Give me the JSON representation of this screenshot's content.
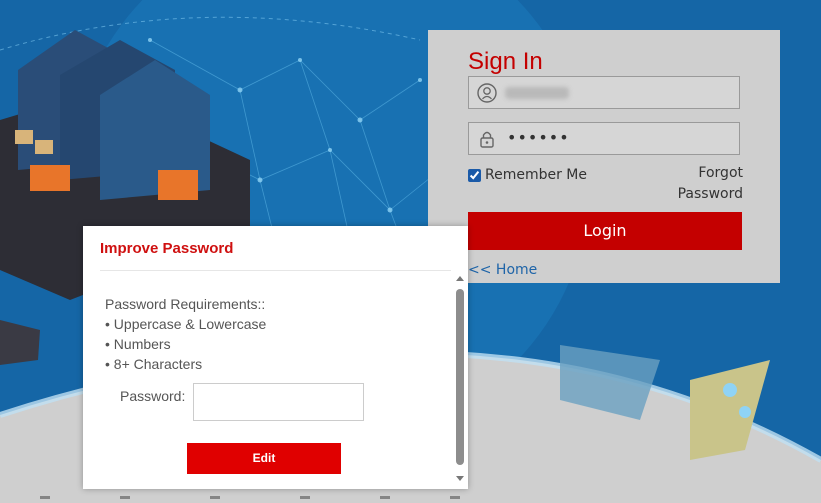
{
  "signin": {
    "title": "Sign In",
    "username_value": "",
    "password_value": "••••••",
    "remember_label": "Remember Me",
    "remember_checked": true,
    "forgot_line1": "Forgot",
    "forgot_line2": "Password",
    "login_label": "Login",
    "home_link": "<< Home"
  },
  "modal": {
    "title": "Improve Password",
    "requirements_heading": "Password Requirements::",
    "requirements": [
      "• Uppercase & Lowercase",
      "• Numbers",
      "• 8+ Characters"
    ],
    "password_label": "Password:",
    "password_value": "",
    "edit_label": "Edit"
  },
  "colors": {
    "accent_red": "#c40000",
    "background_blue": "#1566a6",
    "panel_gray": "#cfcfcf"
  },
  "icons": [
    "user-icon",
    "lock-icon",
    "checkbox-icon",
    "scroll-up-icon",
    "scroll-down-icon"
  ]
}
